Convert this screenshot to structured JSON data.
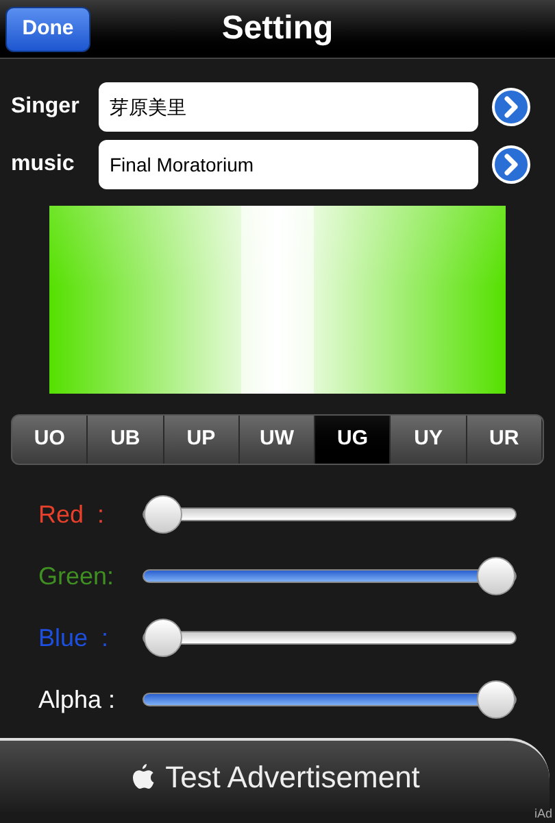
{
  "nav_bar": {
    "title": "Setting",
    "done_button": "Done"
  },
  "fields": [
    {
      "label": "Singer",
      "value": "芽原美里"
    },
    {
      "label": "music",
      "value": "Final Moratorium"
    }
  ],
  "segments": [
    {
      "label": "UO",
      "selected": false
    },
    {
      "label": "UB",
      "selected": false
    },
    {
      "label": "UP",
      "selected": false
    },
    {
      "label": "UW",
      "selected": false
    },
    {
      "label": "UG",
      "selected": true
    },
    {
      "label": "UY",
      "selected": false
    },
    {
      "label": "UR",
      "selected": false
    }
  ],
  "sliders": [
    {
      "label": "Red  :",
      "color": "#e8402a",
      "level": 0
    },
    {
      "label": "Green:",
      "color": "#3f8f22",
      "level": 1
    },
    {
      "label": "Blue  :",
      "color": "#1d4fe0",
      "level": 0
    },
    {
      "label": "Alpha :",
      "color": "#ffffff",
      "level": 1
    }
  ],
  "ad_banner": {
    "text": "Test Advertisement",
    "badge": "iAd"
  }
}
